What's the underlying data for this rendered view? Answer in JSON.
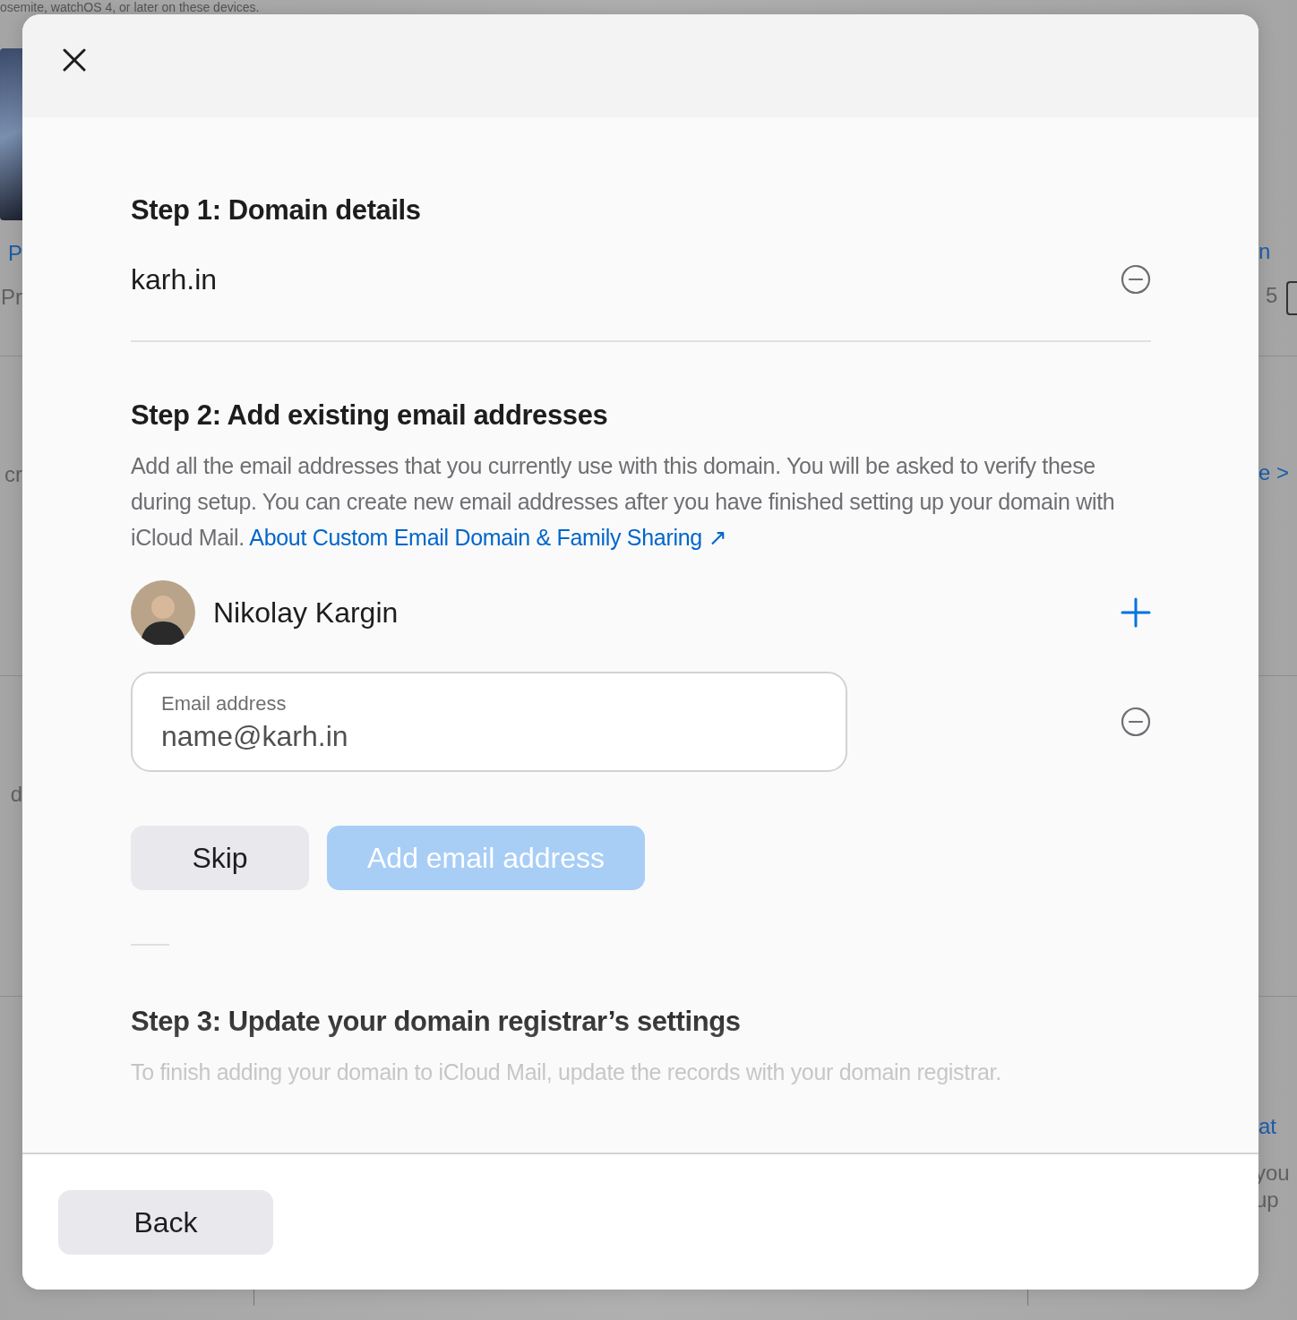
{
  "background_page": {
    "top_line": "osemite, watchOS 4, or later on these devices.",
    "left_fragments": [
      {
        "text": "P",
        "kind": "link"
      },
      {
        "text": "Pr",
        "kind": "muted"
      },
      {
        "text": "cr",
        "kind": "muted"
      },
      {
        "text": "d",
        "kind": "muted"
      }
    ],
    "right_fragments": [
      {
        "text": "n",
        "kind": "link"
      },
      {
        "text": "5",
        "kind": "muted"
      },
      {
        "text": "e >",
        "kind": "link"
      },
      {
        "text": "at",
        "kind": "link"
      },
      {
        "text": "you",
        "kind": "muted"
      },
      {
        "text": "up",
        "kind": "muted"
      }
    ]
  },
  "dialog": {
    "step1": {
      "title": "Step 1: Domain details",
      "domain": "karh.in"
    },
    "step2": {
      "title": "Step 2: Add existing email addresses",
      "description": "Add all the email addresses that you currently use with this domain. You will be asked to verify these during setup. You can create new email addresses after you have finished setting up your domain with iCloud Mail.",
      "link": "About Custom Email Domain & Family Sharing ↗",
      "member": "Nikolay Kargin",
      "email_field": {
        "label": "Email address",
        "value": "name@karh.in"
      },
      "buttons": [
        {
          "label": "Skip",
          "kind": "secondary",
          "disabled": false
        },
        {
          "label": "Add email address",
          "kind": "primary",
          "disabled": true
        }
      ]
    },
    "step3": {
      "title": "Step 3: Update your domain registrar’s settings",
      "description": "To finish adding your domain to iCloud Mail, update the records with your domain registrar."
    },
    "back_button": "Back"
  }
}
